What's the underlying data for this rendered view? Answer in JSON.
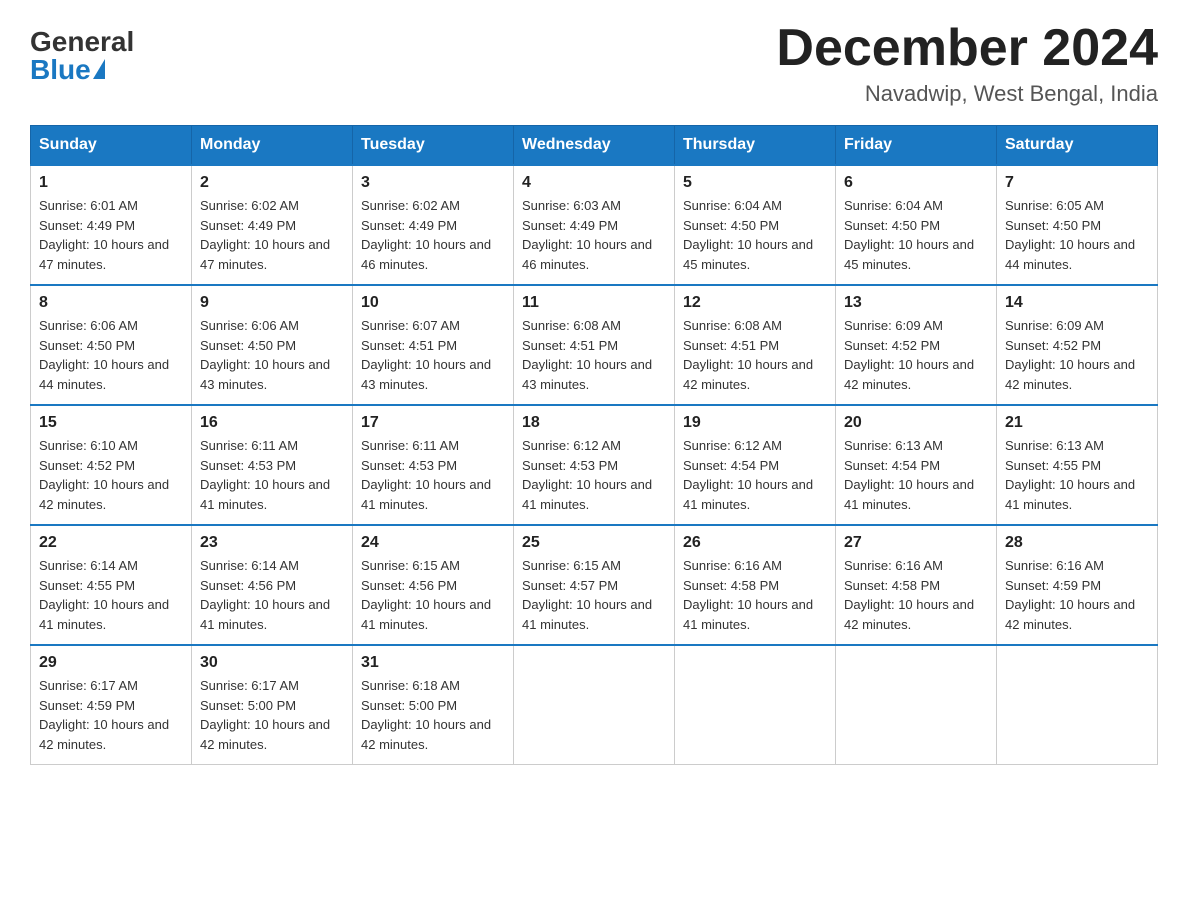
{
  "header": {
    "logo_general": "General",
    "logo_blue": "Blue",
    "month_title": "December 2024",
    "location": "Navadwip, West Bengal, India"
  },
  "days_of_week": [
    "Sunday",
    "Monday",
    "Tuesday",
    "Wednesday",
    "Thursday",
    "Friday",
    "Saturday"
  ],
  "weeks": [
    [
      {
        "day": "1",
        "sunrise": "6:01 AM",
        "sunset": "4:49 PM",
        "daylight": "10 hours and 47 minutes."
      },
      {
        "day": "2",
        "sunrise": "6:02 AM",
        "sunset": "4:49 PM",
        "daylight": "10 hours and 47 minutes."
      },
      {
        "day": "3",
        "sunrise": "6:02 AM",
        "sunset": "4:49 PM",
        "daylight": "10 hours and 46 minutes."
      },
      {
        "day": "4",
        "sunrise": "6:03 AM",
        "sunset": "4:49 PM",
        "daylight": "10 hours and 46 minutes."
      },
      {
        "day": "5",
        "sunrise": "6:04 AM",
        "sunset": "4:50 PM",
        "daylight": "10 hours and 45 minutes."
      },
      {
        "day": "6",
        "sunrise": "6:04 AM",
        "sunset": "4:50 PM",
        "daylight": "10 hours and 45 minutes."
      },
      {
        "day": "7",
        "sunrise": "6:05 AM",
        "sunset": "4:50 PM",
        "daylight": "10 hours and 44 minutes."
      }
    ],
    [
      {
        "day": "8",
        "sunrise": "6:06 AM",
        "sunset": "4:50 PM",
        "daylight": "10 hours and 44 minutes."
      },
      {
        "day": "9",
        "sunrise": "6:06 AM",
        "sunset": "4:50 PM",
        "daylight": "10 hours and 43 minutes."
      },
      {
        "day": "10",
        "sunrise": "6:07 AM",
        "sunset": "4:51 PM",
        "daylight": "10 hours and 43 minutes."
      },
      {
        "day": "11",
        "sunrise": "6:08 AM",
        "sunset": "4:51 PM",
        "daylight": "10 hours and 43 minutes."
      },
      {
        "day": "12",
        "sunrise": "6:08 AM",
        "sunset": "4:51 PM",
        "daylight": "10 hours and 42 minutes."
      },
      {
        "day": "13",
        "sunrise": "6:09 AM",
        "sunset": "4:52 PM",
        "daylight": "10 hours and 42 minutes."
      },
      {
        "day": "14",
        "sunrise": "6:09 AM",
        "sunset": "4:52 PM",
        "daylight": "10 hours and 42 minutes."
      }
    ],
    [
      {
        "day": "15",
        "sunrise": "6:10 AM",
        "sunset": "4:52 PM",
        "daylight": "10 hours and 42 minutes."
      },
      {
        "day": "16",
        "sunrise": "6:11 AM",
        "sunset": "4:53 PM",
        "daylight": "10 hours and 41 minutes."
      },
      {
        "day": "17",
        "sunrise": "6:11 AM",
        "sunset": "4:53 PM",
        "daylight": "10 hours and 41 minutes."
      },
      {
        "day": "18",
        "sunrise": "6:12 AM",
        "sunset": "4:53 PM",
        "daylight": "10 hours and 41 minutes."
      },
      {
        "day": "19",
        "sunrise": "6:12 AM",
        "sunset": "4:54 PM",
        "daylight": "10 hours and 41 minutes."
      },
      {
        "day": "20",
        "sunrise": "6:13 AM",
        "sunset": "4:54 PM",
        "daylight": "10 hours and 41 minutes."
      },
      {
        "day": "21",
        "sunrise": "6:13 AM",
        "sunset": "4:55 PM",
        "daylight": "10 hours and 41 minutes."
      }
    ],
    [
      {
        "day": "22",
        "sunrise": "6:14 AM",
        "sunset": "4:55 PM",
        "daylight": "10 hours and 41 minutes."
      },
      {
        "day": "23",
        "sunrise": "6:14 AM",
        "sunset": "4:56 PM",
        "daylight": "10 hours and 41 minutes."
      },
      {
        "day": "24",
        "sunrise": "6:15 AM",
        "sunset": "4:56 PM",
        "daylight": "10 hours and 41 minutes."
      },
      {
        "day": "25",
        "sunrise": "6:15 AM",
        "sunset": "4:57 PM",
        "daylight": "10 hours and 41 minutes."
      },
      {
        "day": "26",
        "sunrise": "6:16 AM",
        "sunset": "4:58 PM",
        "daylight": "10 hours and 41 minutes."
      },
      {
        "day": "27",
        "sunrise": "6:16 AM",
        "sunset": "4:58 PM",
        "daylight": "10 hours and 42 minutes."
      },
      {
        "day": "28",
        "sunrise": "6:16 AM",
        "sunset": "4:59 PM",
        "daylight": "10 hours and 42 minutes."
      }
    ],
    [
      {
        "day": "29",
        "sunrise": "6:17 AM",
        "sunset": "4:59 PM",
        "daylight": "10 hours and 42 minutes."
      },
      {
        "day": "30",
        "sunrise": "6:17 AM",
        "sunset": "5:00 PM",
        "daylight": "10 hours and 42 minutes."
      },
      {
        "day": "31",
        "sunrise": "6:18 AM",
        "sunset": "5:00 PM",
        "daylight": "10 hours and 42 minutes."
      },
      null,
      null,
      null,
      null
    ]
  ]
}
